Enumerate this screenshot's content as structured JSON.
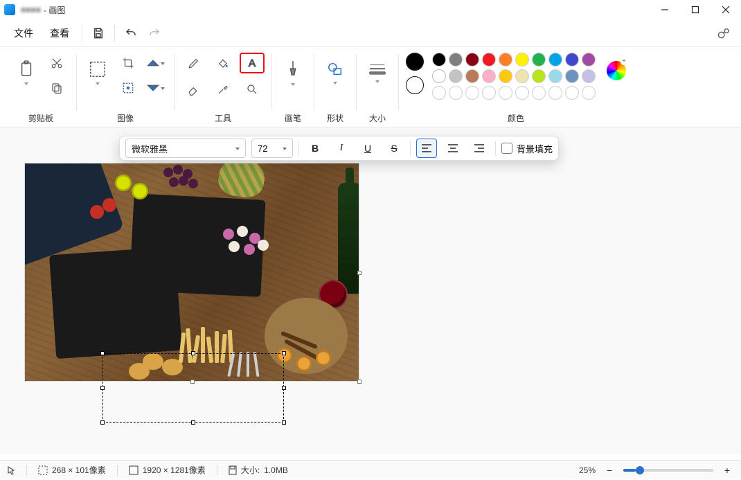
{
  "title": {
    "obscured": "■■■■",
    "suffix": " - 画图"
  },
  "menu": {
    "file": "文件",
    "view": "查看"
  },
  "ribbon": {
    "clipboard": "剪贴板",
    "image": "图像",
    "tools": "工具",
    "brushes": "画笔",
    "shapes": "形状",
    "size": "大小",
    "colors": "颜色"
  },
  "textOptions": {
    "font": "微软雅黑",
    "size": "72",
    "bgFill": "背景填充"
  },
  "palette": {
    "current": "#000000",
    "secondary": "#ffffff",
    "row1": [
      "#000000",
      "#7f7f7f",
      "#880015",
      "#ed1c24",
      "#ff7f27",
      "#fff200",
      "#22b14c",
      "#00a2e8",
      "#3f48cc",
      "#a349a4"
    ],
    "row2": [
      "#ffffff",
      "#c3c3c3",
      "#b97a57",
      "#ffaec9",
      "#ffc90e",
      "#efe4b0",
      "#b5e61d",
      "#99d9ea",
      "#7092be",
      "#c8bfe7"
    ],
    "row3": [
      "",
      "",
      "",
      "",
      "",
      "",
      "",
      "",
      "",
      ""
    ]
  },
  "status": {
    "selection": "268 × 101像素",
    "canvas": "1920 × 1281像素",
    "sizeLabel": "大小: ",
    "sizeValue": "1.0MB",
    "zoom": "25%"
  }
}
